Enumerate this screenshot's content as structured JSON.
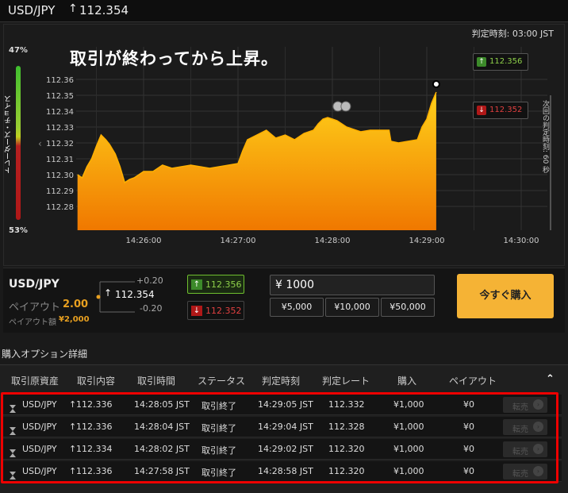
{
  "header": {
    "pair": "USD/JPY",
    "arrow": "↑",
    "price": "112.354"
  },
  "chart_panel": {
    "judgement_label": "判定時刻:",
    "judgement_time": "03:00 JST",
    "overlay_text": "取引が終わってから上昇。",
    "trader_choice": {
      "label": "トレーダーズ・チョイス",
      "top_pct": "47%",
      "bottom_pct": "53%",
      "colors": {
        "high": "#3fbf2f",
        "low": "#b52020"
      }
    },
    "side_high": {
      "icon": "up-arrow-icon",
      "value": "112.356"
    },
    "side_low": {
      "icon": "down-arrow-icon",
      "value": "112.352"
    },
    "next_judgement_label": "次回の判定時刻: 60 秒"
  },
  "chart_data": {
    "type": "area",
    "y_ticks": [
      "112.36",
      "112.35",
      "112.34",
      "112.33",
      "112.32",
      "112.31",
      "112.30",
      "112.29",
      "112.28"
    ],
    "ylim": [
      112.27,
      112.365
    ],
    "x_ticks": [
      "14:26:00",
      "14:27:00",
      "14:28:00",
      "14:29:00",
      "14:30:00"
    ],
    "x_minutes": [
      0,
      1,
      2,
      3,
      4
    ],
    "series": [
      {
        "color": "#f59a00",
        "points": [
          [
            -0.7,
            112.3
          ],
          [
            -0.65,
            112.298
          ],
          [
            -0.6,
            112.305
          ],
          [
            -0.55,
            112.31
          ],
          [
            -0.5,
            112.318
          ],
          [
            -0.45,
            112.325
          ],
          [
            -0.4,
            112.322
          ],
          [
            -0.36,
            112.319
          ],
          [
            -0.3,
            112.313
          ],
          [
            -0.25,
            112.305
          ],
          [
            -0.2,
            112.295
          ],
          [
            -0.15,
            112.297
          ],
          [
            -0.1,
            112.298
          ],
          [
            -0.05,
            112.3
          ],
          [
            0.0,
            112.302
          ],
          [
            0.1,
            112.302
          ],
          [
            0.2,
            112.306
          ],
          [
            0.3,
            112.304
          ],
          [
            0.4,
            112.305
          ],
          [
            0.5,
            112.306
          ],
          [
            0.6,
            112.305
          ],
          [
            0.7,
            112.304
          ],
          [
            0.8,
            112.305
          ],
          [
            0.9,
            112.306
          ],
          [
            1.0,
            112.307
          ],
          [
            1.05,
            112.315
          ],
          [
            1.1,
            112.322
          ],
          [
            1.2,
            112.325
          ],
          [
            1.3,
            112.328
          ],
          [
            1.4,
            112.323
          ],
          [
            1.5,
            112.325
          ],
          [
            1.6,
            112.322
          ],
          [
            1.7,
            112.326
          ],
          [
            1.8,
            112.328
          ],
          [
            1.85,
            112.332
          ],
          [
            1.9,
            112.335
          ],
          [
            1.95,
            112.336
          ],
          [
            2.0,
            112.335
          ],
          [
            2.05,
            112.334
          ],
          [
            2.1,
            112.332
          ],
          [
            2.15,
            112.33
          ],
          [
            2.2,
            112.329
          ],
          [
            2.3,
            112.327
          ],
          [
            2.4,
            112.328
          ],
          [
            2.5,
            112.328
          ],
          [
            2.6,
            112.328
          ],
          [
            2.62,
            112.321
          ],
          [
            2.7,
            112.32
          ],
          [
            2.8,
            112.321
          ],
          [
            2.9,
            112.322
          ],
          [
            2.95,
            112.33
          ],
          [
            3.0,
            112.335
          ],
          [
            3.05,
            112.345
          ],
          [
            3.1,
            112.352
          ]
        ]
      }
    ],
    "end_marker": [
      3.1,
      112.352
    ],
    "pins_at": [
      2.1,
      112.339
    ],
    "grid": true
  },
  "trade_panel": {
    "pair": "USD/JPY",
    "payout_label": "ペイアウト",
    "payout_value": "2.00",
    "payout_amount_label": "ペイアウト額",
    "payout_amount": "¥2,000",
    "tick_plus": "+0.20",
    "tick_minus": "-0.20",
    "current_price": "112.354",
    "current_arrow": "↑",
    "high_button": {
      "icon": "up-arrow-icon",
      "value": "112.356"
    },
    "low_button": {
      "icon": "down-arrow-icon",
      "value": "112.352"
    },
    "amount": "¥ 1000",
    "quick_amounts": [
      "¥5,000",
      "¥10,000",
      "¥50,000"
    ],
    "buy_now": "今すぐ購入"
  },
  "details": {
    "title": "購入オプション詳細",
    "headers": [
      "取引原資産",
      "取引内容",
      "取引時間",
      "ステータス",
      "判定時刻",
      "判定レート",
      "購入",
      "ペイアウト"
    ],
    "rows": [
      {
        "asset": "USD/JPY",
        "arrow": "↑",
        "entry": "112.336",
        "time": "14:28:05 JST",
        "status": "取引終了",
        "judge": "14:29:05 JST",
        "rate": "112.332",
        "buy": "¥1,000",
        "payout": "¥0",
        "sell": "転売"
      },
      {
        "asset": "USD/JPY",
        "arrow": "↑",
        "entry": "112.336",
        "time": "14:28:04 JST",
        "status": "取引終了",
        "judge": "14:29:04 JST",
        "rate": "112.328",
        "buy": "¥1,000",
        "payout": "¥0",
        "sell": "転売"
      },
      {
        "asset": "USD/JPY",
        "arrow": "↑",
        "entry": "112.334",
        "time": "14:28:02 JST",
        "status": "取引終了",
        "judge": "14:29:02 JST",
        "rate": "112.320",
        "buy": "¥1,000",
        "payout": "¥0",
        "sell": "転売"
      },
      {
        "asset": "USD/JPY",
        "arrow": "↑",
        "entry": "112.336",
        "time": "14:27:58 JST",
        "status": "取引終了",
        "judge": "14:28:58 JST",
        "rate": "112.320",
        "buy": "¥1,000",
        "payout": "¥0",
        "sell": "転売"
      }
    ]
  }
}
